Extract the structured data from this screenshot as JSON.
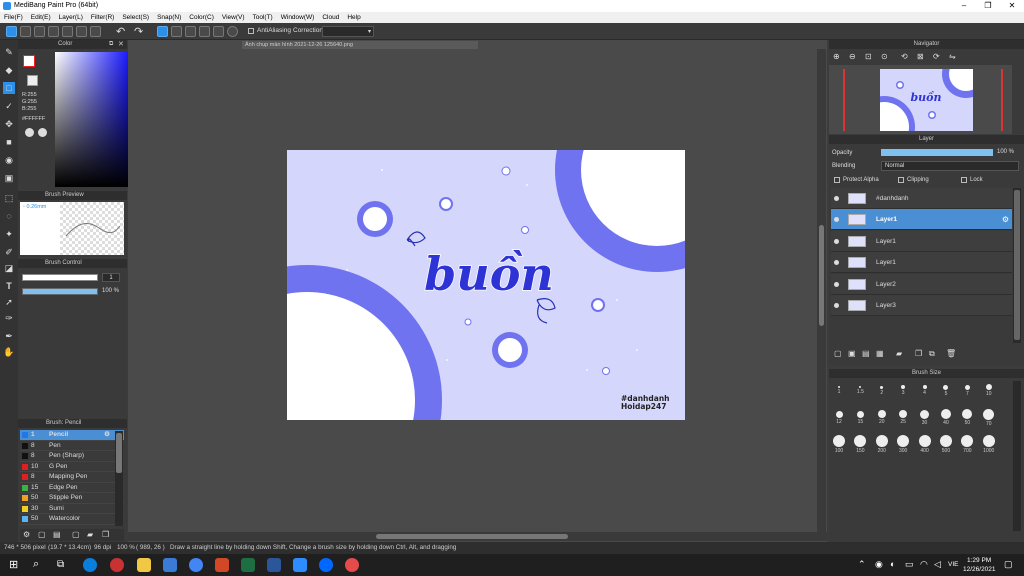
{
  "window": {
    "title": "MediBang Paint Pro (64bit)"
  },
  "menu": [
    "File(F)",
    "Edit(E)",
    "Layer(L)",
    "Filter(R)",
    "Select(S)",
    "Snap(N)",
    "Color(C)",
    "View(V)",
    "Tool(T)",
    "Window(W)",
    "Cloud",
    "Help"
  ],
  "toolbar": {
    "antialiasing": "AntiAliasing",
    "correction": "Correction"
  },
  "color_panel": {
    "title": "Color",
    "r": "R:255",
    "g": "G:255",
    "b": "B:255",
    "hex": "#FFFFFF",
    "fg": "#ffffff",
    "bg": "#e8e8e8"
  },
  "brush_preview": {
    "title": "Brush Preview",
    "size": "0.26mm"
  },
  "brush_control": {
    "title": "Brush Control",
    "size": "1",
    "opacity": "100 %",
    "opacity_value": 100
  },
  "brush_list": {
    "title": "Brush: Pencil",
    "items": [
      {
        "color": "#1f77e8",
        "size": "1",
        "name": "Pencil"
      },
      {
        "color": "#111111",
        "size": "8",
        "name": "Pen"
      },
      {
        "color": "#111111",
        "size": "8",
        "name": "Pen (Sharp)"
      },
      {
        "color": "#e02020",
        "size": "10",
        "name": "G Pen"
      },
      {
        "color": "#e02020",
        "size": "8",
        "name": "Mapping Pen"
      },
      {
        "color": "#3cb043",
        "size": "15",
        "name": "Edge Pen"
      },
      {
        "color": "#f0a020",
        "size": "50",
        "name": "Stipple Pen"
      },
      {
        "color": "#f0d020",
        "size": "30",
        "name": "Sumi"
      },
      {
        "color": "#5ab4f0",
        "size": "50",
        "name": "Watercolor"
      }
    ]
  },
  "document": {
    "tab": "Ảnh chụp màn hình 2021-12-26 125640.png"
  },
  "artwork": {
    "word": "buồn",
    "caption1": "#danhdanh",
    "caption2": "Hoidap247",
    "accent": "#6f73ef",
    "bg": "#d5d6fb"
  },
  "navigator": {
    "title": "Navigator"
  },
  "layer_panel": {
    "title": "Layer",
    "opacity_label": "Opacity",
    "opacity": "100 %",
    "opacity_value": 100,
    "blending_label": "Blending",
    "blending": "Normal",
    "protect_alpha": "Protect Alpha",
    "clipping": "Clipping",
    "lock": "Lock",
    "layers": [
      {
        "name": "#danhdanh",
        "selected": false
      },
      {
        "name": "Layer1",
        "selected": true
      },
      {
        "name": "Layer1",
        "selected": false
      },
      {
        "name": "Layer1",
        "selected": false
      },
      {
        "name": "Layer2",
        "selected": false
      },
      {
        "name": "Layer3",
        "selected": false
      }
    ]
  },
  "brush_size": {
    "title": "Brush Size",
    "sizes": [
      "1",
      "1.5",
      "2",
      "3",
      "4",
      "5",
      "7",
      "10",
      "12",
      "15",
      "20",
      "25",
      "30",
      "40",
      "50",
      "70",
      "100",
      "150",
      "200",
      "300",
      "400",
      "500",
      "700",
      "1000"
    ]
  },
  "status": {
    "dims": "746 * 506 pixel",
    "cm": "(19.7 * 13.4cm)",
    "dpi": "96 dpi",
    "zoom": "100 %",
    "coords": "( 989, 26 )",
    "hint": "Draw a straight line by holding down Shift, Change a brush size by holding down Ctrl, Alt, and dragging"
  },
  "taskbar": {
    "time": "1:29 PM",
    "date": "12/26/2021",
    "lang": "VIE"
  }
}
